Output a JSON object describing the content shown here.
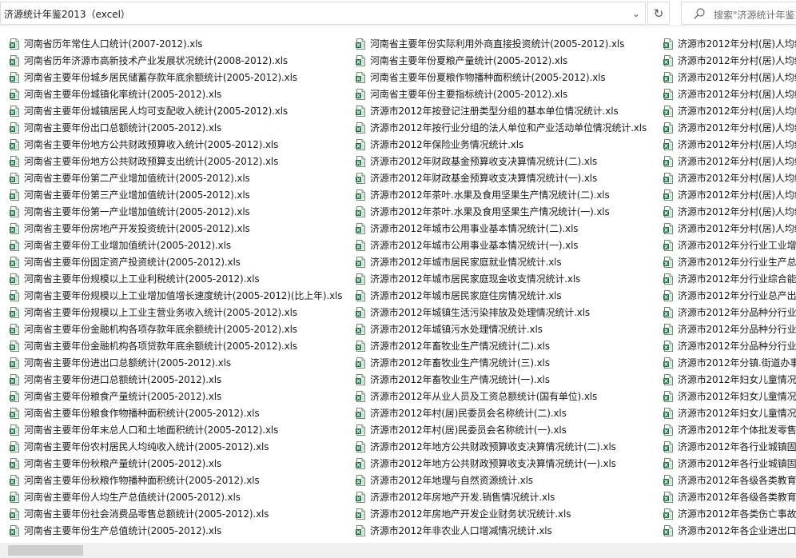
{
  "address_bar": {
    "path": "济源统计年鉴2013（excel）"
  },
  "search": {
    "placeholder": "搜索\"济源统计年鉴2013（excel）\""
  },
  "icons": {
    "dropdown": "chevron-down-icon",
    "refresh": "refresh-icon",
    "search": "search-icon",
    "file": "excel-file-icon"
  },
  "colors": {
    "excel_green": "#1e7145",
    "scroll_thumb": "#cdcdcd"
  },
  "columns": [
    {
      "files": [
        "河南省历年常住人口统计(2007-2012).xls",
        "河南省历年济源市高新技术产业发展状况统计(2008-2012).xls",
        "河南省主要年份城乡居民储蓄存款年底余额统计(2005-2012).xls",
        "河南省主要年份城镇化率统计(2005-2012).xls",
        "河南省主要年份城镇居民人均可支配收入统计(2005-2012).xls",
        "河南省主要年份出口总额统计(2005-2012).xls",
        "河南省主要年份地方公共财政预算收入统计(2005-2012).xls",
        "河南省主要年份地方公共财政预算支出统计(2005-2012).xls",
        "河南省主要年份第二产业增加值统计(2005-2012).xls",
        "河南省主要年份第三产业增加值统计(2005-2012).xls",
        "河南省主要年份第一产业增加值统计(2005-2012).xls",
        "河南省主要年份房地产开发投资统计(2005-2012).xls",
        "河南省主要年份工业增加值统计(2005-2012).xls",
        "河南省主要年份固定资产投资统计(2005-2012).xls",
        "河南省主要年份规模以上工业利税统计(2005-2012).xls",
        "河南省主要年份规模以上工业增加值增长速度统计(2005-2012)(比上年).xls",
        "河南省主要年份规模以上工业主营业务收入统计(2005-2012).xls",
        "河南省主要年份金融机构各项存款年底余额统计(2005-2012).xls",
        "河南省主要年份金融机构各项贷款年底余额统计(2005-2012).xls",
        "河南省主要年份进出口总额统计(2005-2012).xls",
        "河南省主要年份进口总额统计(2005-2012).xls",
        "河南省主要年份粮食产量统计(2005-2012).xls",
        "河南省主要年份粮食作物播种面积统计(2005-2012).xls",
        "河南省主要年份年末总人口和土地面积统计(2005-2012).xls",
        "河南省主要年份农村居民人均纯收入统计(2005-2012).xls",
        "河南省主要年份秋粮产量统计(2005-2012).xls",
        "河南省主要年份秋粮作物播种面积统计(2005-2012).xls",
        "河南省主要年份人均生产总值统计(2005-2012).xls",
        "河南省主要年份社会消费品零售总额统计(2005-2012).xls",
        "河南省主要年份生产总值统计(2005-2012).xls"
      ]
    },
    {
      "files": [
        "河南省主要年份实际利用外商直接投资统计(2005-2012).xls",
        "河南省主要年份夏粮产量统计(2005-2012).xls",
        "河南省主要年份夏粮作物播种面积统计(2005-2012).xls",
        "河南省主要年份主要指标统计(2005-2012).xls",
        "济源市2012年按登记注册类型分组的基本单位情况统计.xls",
        "济源市2012年按行业分组的法人单位和产业活动单位情况统计.xls",
        "济源市2012年保险业务情况统计.xls",
        "济源市2012年财政基金预算收支决算情况统计(二).xls",
        "济源市2012年财政基金预算收支决算情况统计(一).xls",
        "济源市2012年茶叶.水果及食用坚果生产情况统计(二).xls",
        "济源市2012年茶叶.水果及食用坚果生产情况统计(一).xls",
        "济源市2012年城市公用事业基本情况统计(二).xls",
        "济源市2012年城市公用事业基本情况统计(一).xls",
        "济源市2012年城市居民家庭就业情况统计.xls",
        "济源市2012年城市居民家庭现金收支情况统计.xls",
        "济源市2012年城市居民家庭住房情况统计.xls",
        "济源市2012年城镇生活污染排放及处理情况统计.xls",
        "济源市2012年城镇污水处理情况统计.xls",
        "济源市2012年畜牧业生产情况统计(二).xls",
        "济源市2012年畜牧业生产情况统计(三).xls",
        "济源市2012年畜牧业生产情况统计(一).xls",
        "济源市2012年从业人员及工资总额统计(国有单位).xls",
        "济源市2012年村(居)民委员会名称统计(二).xls",
        "济源市2012年村(居)民委员会名称统计(一).xls",
        "济源市2012年地方公共财政预算收支决算情况统计(二).xls",
        "济源市2012年地方公共财政预算收支决算情况统计(一).xls",
        "济源市2012年地理与自然资源统计.xls",
        "济源市2012年房地产开发.销售情况统计.xls",
        "济源市2012年房地产开发企业财务状况统计.xls",
        "济源市2012年非农业人口增减情况统计.xls"
      ]
    },
    {
      "files": [
        "济源市2012年分村(居)人均纯",
        "济源市2012年分村(居)人均纯",
        "济源市2012年分村(居)人均纯",
        "济源市2012年分村(居)人均纯",
        "济源市2012年分村(居)人均纯",
        "济源市2012年分村(居)人均纯",
        "济源市2012年分村(居)人均纯",
        "济源市2012年分村(居)人均纯",
        "济源市2012年分村(居)人均纯",
        "济源市2012年分村(居)人均纯",
        "济源市2012年分村(居)人均纯",
        "济源市2012年分村(居)人均纯",
        "济源市2012年分行业工业增",
        "济源市2012年分行业生产总",
        "济源市2012年分行业综合能",
        "济源市2012年分行业总产出",
        "济源市2012年分品种分行业",
        "济源市2012年分品种分行业",
        "济源市2012年分品种分行业",
        "济源市2012年分镇.街道办事",
        "济源市2012年妇女儿童情况",
        "济源市2012年妇女儿童情况",
        "济源市2012年妇女儿童情况",
        "济源市2012年个体批发零售",
        "济源市2012年各行业城镇固",
        "济源市2012年各行业城镇固",
        "济源市2012年各级各类教育",
        "济源市2012年各级各类教育",
        "济源市2012年各类伤亡事故",
        "济源市2012年各企业进出口"
      ]
    }
  ]
}
